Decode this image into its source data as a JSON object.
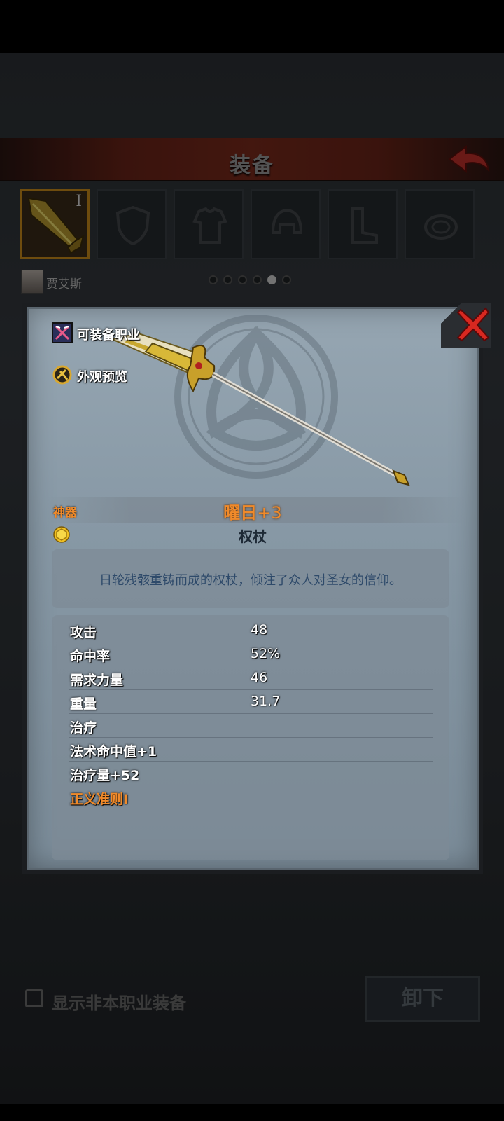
{
  "header": {
    "title": "装备"
  },
  "slots": [
    {
      "roman": "I",
      "icon": "spear-icon",
      "selected": true
    },
    {
      "roman": "",
      "icon": "shield-icon",
      "selected": false
    },
    {
      "roman": "",
      "icon": "armor-icon",
      "selected": false
    },
    {
      "roman": "",
      "icon": "helmet-icon",
      "selected": false
    },
    {
      "roman": "",
      "icon": "boots-icon",
      "selected": false
    },
    {
      "roman": "",
      "icon": "ring-icon",
      "selected": false
    }
  ],
  "character": {
    "name": "贾艾斯"
  },
  "pagination": {
    "total": 6,
    "current": 5
  },
  "bottom": {
    "checkbox_label": "显示非本职业装备",
    "checked": false,
    "unequip_label": "卸下"
  },
  "modal": {
    "tags": {
      "class_label": "可装备职业",
      "preview_label": "外观预览"
    },
    "rarity": "神器",
    "item_name": "曜日",
    "enhance": "+3",
    "item_type": "权杖",
    "description": "日轮残骸重铸而成的权杖，倾注了众人对圣女的信仰。",
    "stats": [
      {
        "label": "攻击",
        "value": "48"
      },
      {
        "label": "命中率",
        "value": "52%"
      },
      {
        "label": "需求力量",
        "value": "46"
      },
      {
        "label": "重量",
        "value": "31.7"
      },
      {
        "label": "治疗",
        "value": ""
      },
      {
        "label": "法术命中值+1",
        "value": ""
      },
      {
        "label": "治疗量+52",
        "value": ""
      },
      {
        "label": "正义准则I",
        "value": "",
        "highlight": true
      }
    ]
  },
  "colors": {
    "rarity": "#f08a2a",
    "header_red": "#7a2a1c",
    "slot_selected": "#c88a1a"
  }
}
